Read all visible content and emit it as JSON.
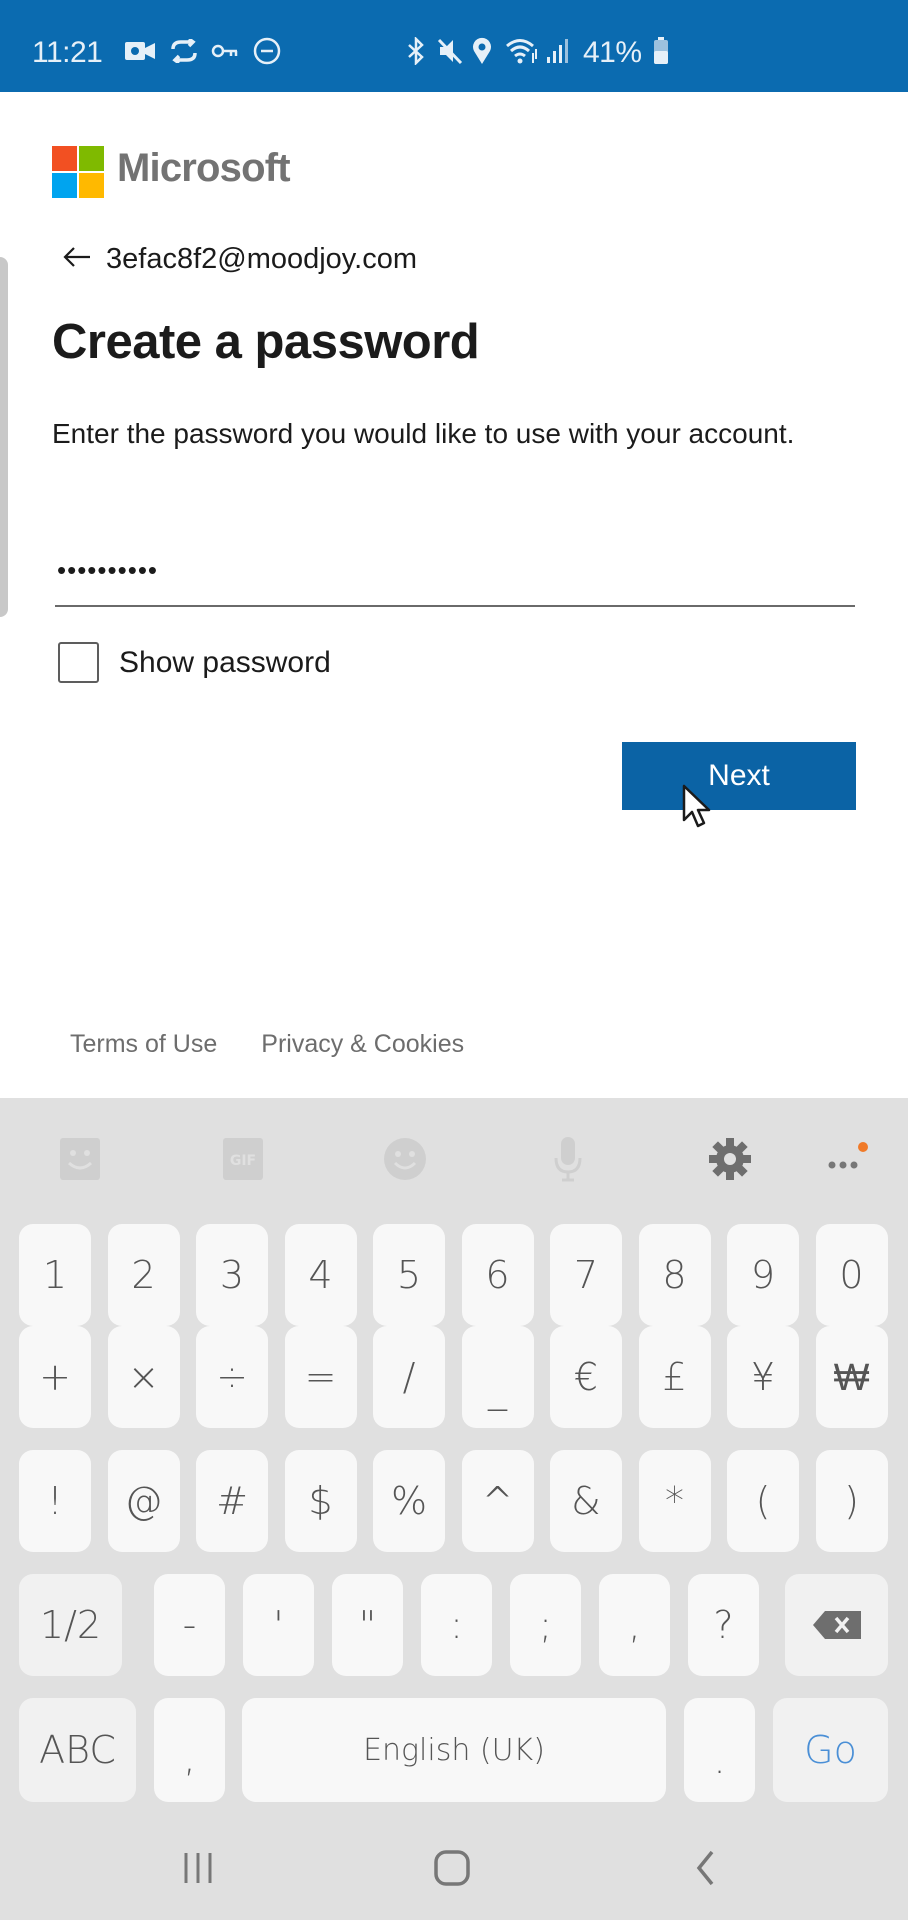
{
  "status_bar": {
    "time": "11:21",
    "battery_percent": "41%",
    "left_icons": [
      "video-call-icon",
      "sync-icon",
      "vpn-key-icon",
      "do-not-disturb-icon"
    ],
    "right_icons": [
      "bluetooth-icon",
      "mute-icon",
      "location-icon",
      "wifi-icon",
      "signal-icon",
      "battery-icon"
    ],
    "background_color": "#0b6bb0"
  },
  "brand": {
    "name": "Microsoft",
    "logo_colors": [
      "#f25022",
      "#7fba00",
      "#00a4ef",
      "#ffb900"
    ]
  },
  "account": {
    "email": "3efac8f2@moodjoy.com"
  },
  "page": {
    "title": "Create a password",
    "description": "Enter the password you would like to use with your account.",
    "password_value": "••••••••••",
    "show_password_label": "Show password",
    "show_password_checked": false,
    "next_label": "Next",
    "accent_color": "#0b63a5"
  },
  "footer": {
    "links": [
      "Terms of Use",
      "Privacy & Cookies"
    ]
  },
  "keyboard": {
    "toolbar": [
      "sticker-icon",
      "gif-icon",
      "emoji-icon",
      "microphone-icon",
      "settings-gear-icon",
      "more-options-icon"
    ],
    "row1": [
      "1",
      "2",
      "3",
      "4",
      "5",
      "6",
      "7",
      "8",
      "9",
      "0"
    ],
    "row2": [
      "+",
      "×",
      "÷",
      "=",
      "/",
      "_",
      "€",
      "£",
      "¥",
      "₩"
    ],
    "row3": [
      "!",
      "@",
      "#",
      "$",
      "%",
      "^",
      "&",
      "*",
      "(",
      ")"
    ],
    "row4": {
      "page_toggle": "1/2",
      "keys": [
        "-",
        "'",
        "\"",
        ":",
        ";",
        ",",
        "?"
      ],
      "backspace": "backspace-icon"
    },
    "row5": {
      "abc": "ABC",
      "comma": ",",
      "space": "English (UK)",
      "period": ".",
      "action": "Go"
    }
  },
  "nav_bar": {
    "buttons": [
      "recent-apps-icon",
      "home-icon",
      "back-icon"
    ]
  }
}
